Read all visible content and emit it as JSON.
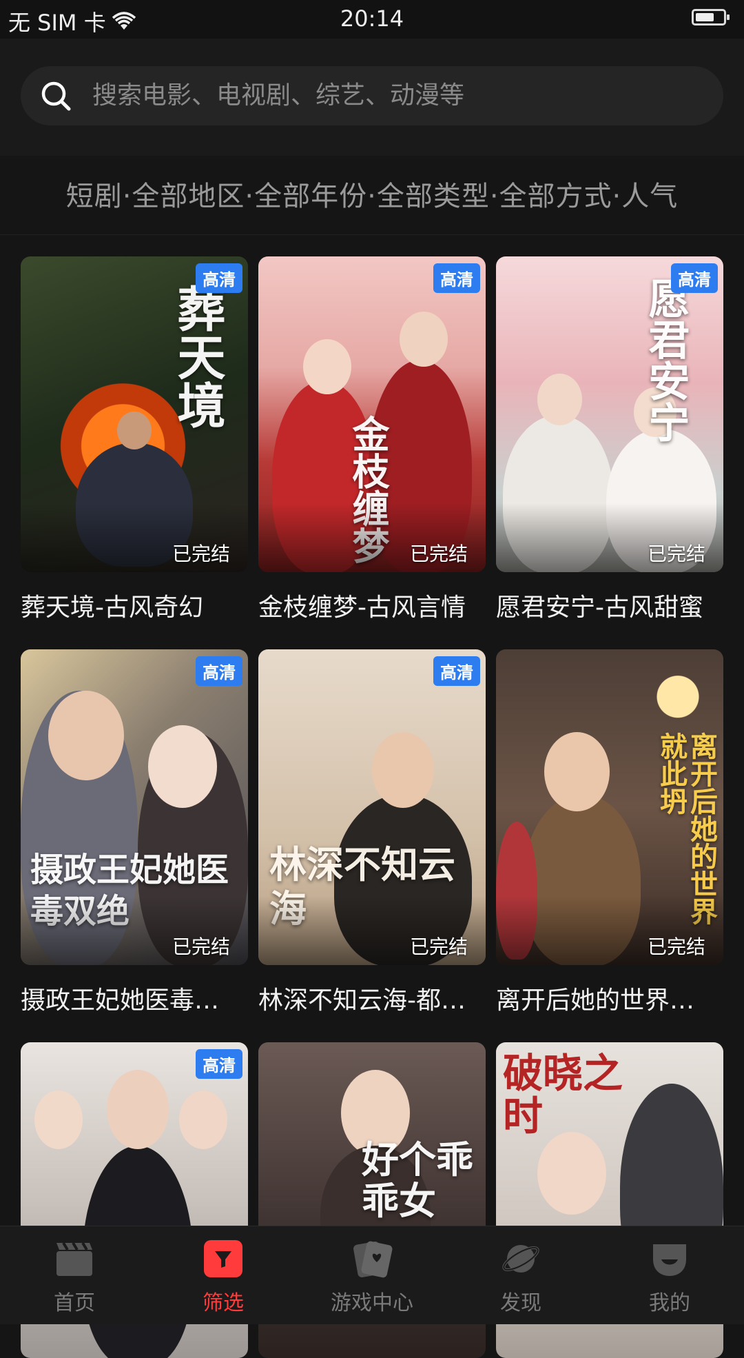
{
  "status_bar": {
    "carrier": "无 SIM 卡",
    "time": "20:14"
  },
  "search": {
    "placeholder": "搜索电影、电视剧、综艺、动漫等"
  },
  "filter": {
    "text": "短剧·全部地区·全部年份·全部类型·全部方式·人气"
  },
  "items": [
    {
      "title": "葬天境-古风奇幻",
      "badge": "高清",
      "status": "已完结",
      "poster_text": "葬天境"
    },
    {
      "title": "金枝缠梦-古风言情",
      "badge": "高清",
      "status": "已完结",
      "poster_text": "金枝缠梦"
    },
    {
      "title": "愿君安宁-古风甜蜜",
      "badge": "高清",
      "status": "已完结",
      "poster_text": "愿君安宁"
    },
    {
      "title": "摄政王妃她医毒…",
      "badge": "高清",
      "status": "已完结",
      "poster_text": "摄政王妃她医毒双绝"
    },
    {
      "title": "林深不知云海-都…",
      "badge": "高清",
      "status": "已完结",
      "poster_text": "林深不知云海"
    },
    {
      "title": "离开后她的世界…",
      "badge": "",
      "status": "已完结",
      "poster_text": "离开后她的世界就此坍"
    },
    {
      "title": "",
      "badge": "高清",
      "status": "",
      "poster_text": ""
    },
    {
      "title": "",
      "badge": "",
      "status": "",
      "poster_text": "好个乖乖女"
    },
    {
      "title": "",
      "badge": "",
      "status": "",
      "poster_text": "破晓之时"
    }
  ],
  "nav": [
    {
      "label": "首页",
      "icon": "clapperboard-icon"
    },
    {
      "label": "筛选",
      "icon": "filter-icon",
      "active": true
    },
    {
      "label": "游戏中心",
      "icon": "cards-icon"
    },
    {
      "label": "发现",
      "icon": "planet-icon"
    },
    {
      "label": "我的",
      "icon": "face-icon"
    }
  ],
  "colors": {
    "accent": "#ff3b3b",
    "badge": "#2d7cf0",
    "background": "#151515"
  }
}
